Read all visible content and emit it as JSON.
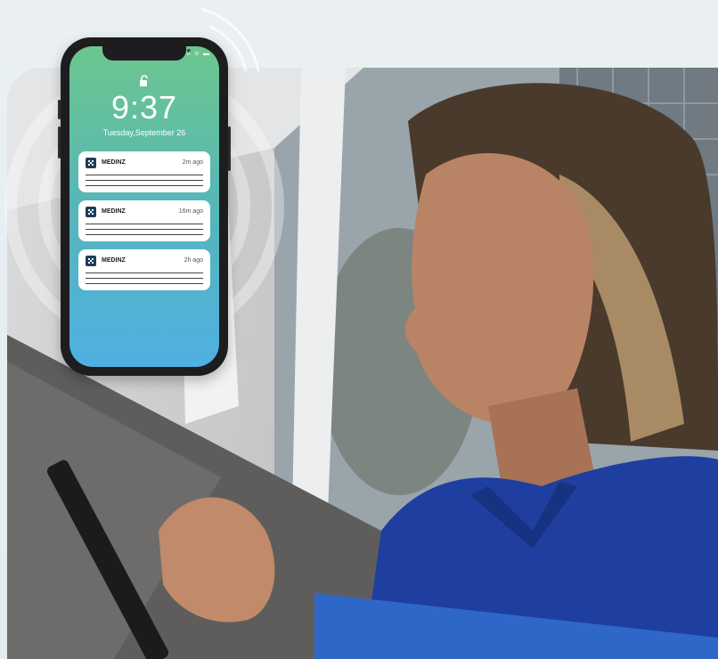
{
  "phone": {
    "time": "9:37",
    "date": "Tuesday,September 26",
    "status_icons": "ıl ᯤ ▬",
    "notifications": [
      {
        "app": "MEDINZ",
        "time": "2m ago"
      },
      {
        "app": "MEDINZ",
        "time": "16m ago"
      },
      {
        "app": "MEDINZ",
        "time": "2h ago"
      }
    ]
  },
  "colors": {
    "screen_top": "#6cc78d",
    "screen_bottom": "#4fb0e3",
    "scrubs": "#1f3fa0",
    "folder": "#2f67c8",
    "brand_logo": "#1f3d57"
  }
}
